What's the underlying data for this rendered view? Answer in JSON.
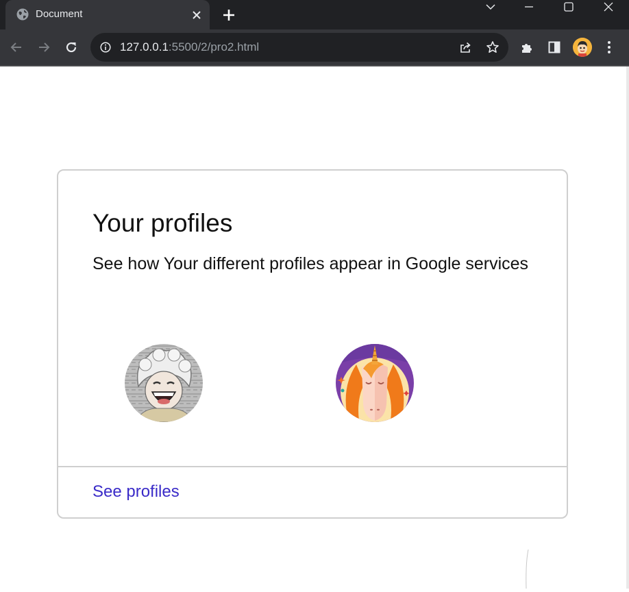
{
  "browser": {
    "tab_title": "Document",
    "url_host": "127.0.0.1",
    "url_path": ":5500/2/pro2.html",
    "colors": {
      "chrome_dark": "#202124",
      "chrome_mid": "#35363a",
      "text": "#e8eaed"
    }
  },
  "icons": {
    "tab_favicon": "globe-icon",
    "close_tab": "close-icon",
    "new_tab": "plus-icon",
    "back": "arrow-left-icon",
    "forward": "arrow-right-icon",
    "reload": "reload-icon",
    "site_info": "info-icon",
    "share": "share-icon",
    "bookmark": "star-icon",
    "extensions": "puzzle-icon",
    "side_panel": "side-panel-icon",
    "profile": "avatar",
    "menu": "kebab-menu-icon",
    "window_minimize": "minimize-icon",
    "window_maximize": "maximize-icon",
    "window_close": "window-close-icon",
    "tab_search": "chevron-down-icon"
  },
  "card": {
    "title": "Your profiles",
    "subtitle": "See how Your different profiles appear in Google services",
    "profiles": [
      {
        "image": "anime-character-avatar"
      },
      {
        "image": "unicorn-avatar"
      }
    ],
    "link_label": "See profiles",
    "link_color": "#3a2bc8"
  }
}
